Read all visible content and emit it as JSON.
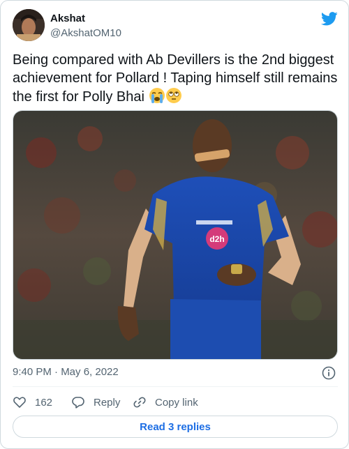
{
  "user": {
    "name": "Akshat",
    "handle": "@AkshatOM10"
  },
  "tweet": {
    "text": "Being compared with Ab Devillers is the 2nd biggest achievement for Pollard ! Taping himself still remains the first for Polly Bhai",
    "emojis": [
      "loudly-crying-face",
      "face-with-rolling-eyes"
    ],
    "media_alt": "Photo of a cricketer in a blue jersey with tape over his mouth"
  },
  "meta": {
    "timestamp": "9:40 PM · May 6, 2022"
  },
  "actions": {
    "like_count": "162",
    "reply_label": "Reply",
    "copy_label": "Copy link"
  },
  "read_replies_label": "Read 3 replies",
  "colors": {
    "twitter_blue": "#1d9bf0",
    "link_blue": "#1d6ee4",
    "secondary_text": "#536471",
    "border": "#cfd9de"
  }
}
